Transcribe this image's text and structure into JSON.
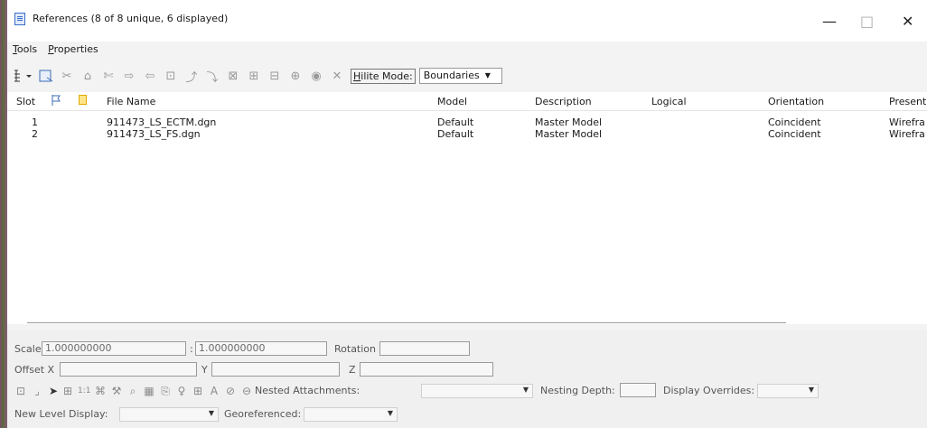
{
  "window": {
    "title": "References (8 of 8 unique, 6 displayed)",
    "controls": {
      "minimize": "—",
      "maximize": "□",
      "close": "✕"
    }
  },
  "menu": [
    {
      "label": "Tools",
      "accel": "T"
    },
    {
      "label": "Properties",
      "accel": "P"
    }
  ],
  "toolbar": {
    "icons": [
      "tree-view-icon",
      "attach-reference-icon",
      "detach-icon",
      "reload-icon",
      "exchange-icon",
      "move-icon",
      "copy-icon",
      "scale-icon",
      "rotate-icon",
      "mirror-h-icon",
      "mirror-v-icon",
      "clip-boundary-icon",
      "clip-mask-icon",
      "delete-mask-icon",
      "clip-front-icon",
      "clip-back-icon",
      "x-clip-icon"
    ],
    "hilite_label": "Hilite Mode:",
    "hilite_value": "Boundaries"
  },
  "columns": {
    "slot": "Slot",
    "file_name": "File Name",
    "model": "Model",
    "description": "Description",
    "logical": "Logical",
    "orientation": "Orientation",
    "presentation": "Present"
  },
  "rows": [
    {
      "slot": "1",
      "file": "911473_LS_ECTM.dgn",
      "model": "Default",
      "description": "Master Model",
      "logical": "",
      "orientation": "Coincident",
      "presentation": "Wirefra"
    },
    {
      "slot": "2",
      "file": "911473_LS_FS.dgn",
      "model": "Default",
      "description": "Master Model",
      "logical": "",
      "orientation": "Coincident",
      "presentation": "Wirefra"
    }
  ],
  "settings": {
    "scale_label": "Scale",
    "scale_value": "1.000000000",
    "colon": ":",
    "scale_value2": "1.000000000",
    "rotation_label": "Rotation",
    "offset_x_label": "Offset X",
    "y_label": "Y",
    "z_label": "Z",
    "nested_label": "Nested Attachments:",
    "nesting_depth_label": "Nesting Depth:",
    "display_overrides_label": "Display Overrides:",
    "new_level_label": "New Level Display:",
    "georeferenced_label": "Georeferenced:"
  },
  "setting_icons": [
    "display-icon",
    "snap-icon",
    "locate-icon",
    "true-scale-icon",
    "scale-line-icon",
    "treat-as-element-icon",
    "tool-icon",
    "raster-icon",
    "lighting-icon",
    "global-lighting-icon",
    "level-icon",
    "text-icon",
    "ignore-icon",
    "lock-icon"
  ]
}
